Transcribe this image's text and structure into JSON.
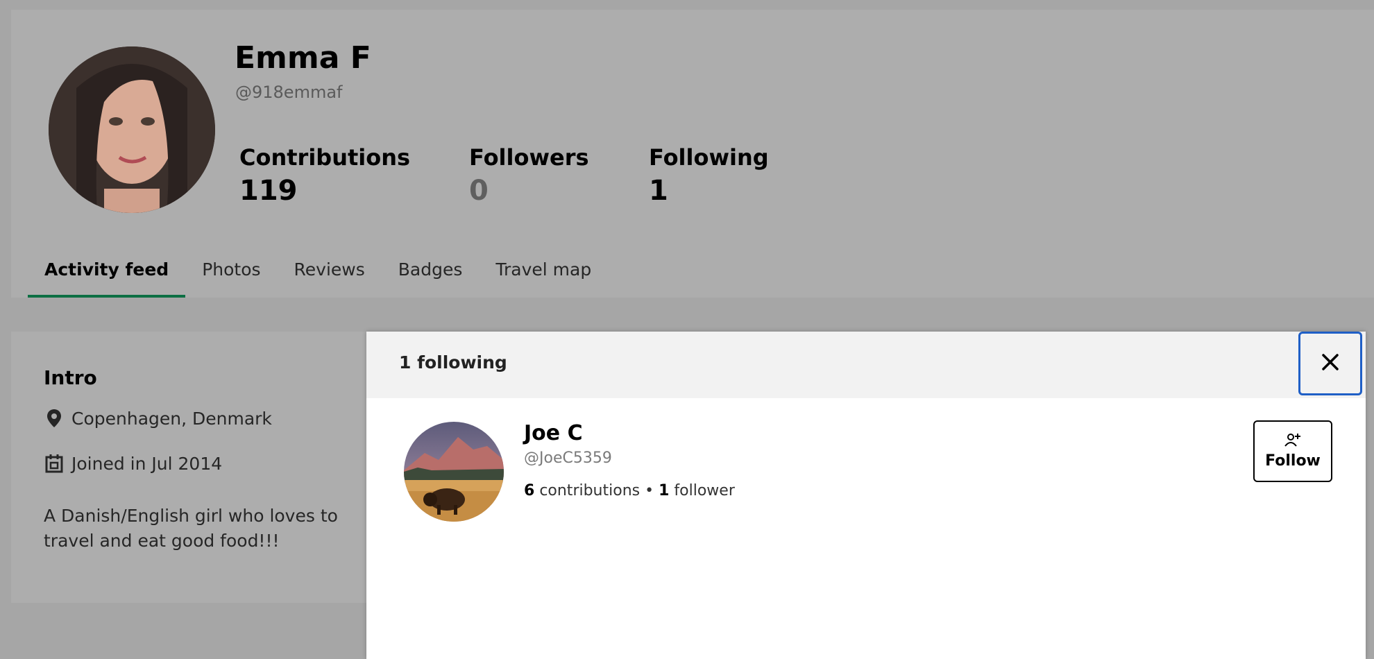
{
  "profile": {
    "name": "Emma F",
    "handle": "@918emmaf",
    "stats": [
      {
        "label": "Contributions",
        "value": "119"
      },
      {
        "label": "Followers",
        "value": "0"
      },
      {
        "label": "Following",
        "value": "1"
      }
    ]
  },
  "tabs": [
    {
      "label": "Activity feed",
      "active": true
    },
    {
      "label": "Photos",
      "active": false
    },
    {
      "label": "Reviews",
      "active": false
    },
    {
      "label": "Badges",
      "active": false
    },
    {
      "label": "Travel map",
      "active": false
    }
  ],
  "intro": {
    "title": "Intro",
    "location": "Copenhagen, Denmark",
    "joined": "Joined in Jul 2014",
    "bio": "A Danish/English girl who loves to travel and eat good food!!!"
  },
  "modal": {
    "title": "1 following",
    "close_icon": "close-icon",
    "users": [
      {
        "name": "Joe C",
        "handle": "@JoeC5359",
        "contributions_count": "6",
        "contributions_word": "contributions",
        "separator": "•",
        "followers_count": "1",
        "followers_word": "follower",
        "follow_label": "Follow",
        "follow_icon": "person-add-icon"
      }
    ]
  },
  "colors": {
    "page_overlay": "#a6a6a6",
    "active_tab_underline": "#0c6f43",
    "focus_ring": "#1f5fc6",
    "modal_header": "#f2f2f2"
  }
}
